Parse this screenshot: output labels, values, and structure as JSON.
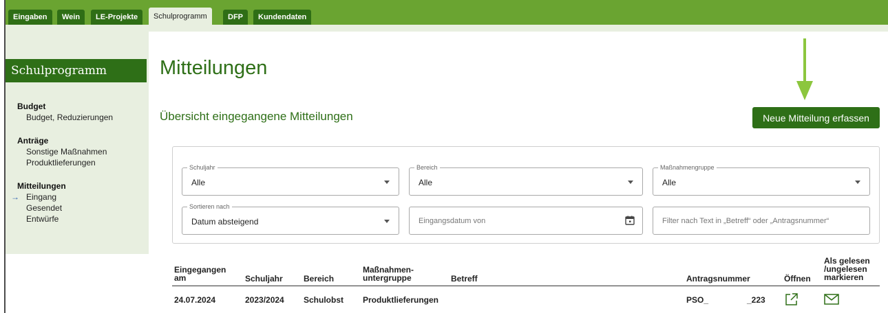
{
  "top_tabs": [
    {
      "label": "Eingaben",
      "active": false
    },
    {
      "label": "Wein",
      "active": false
    },
    {
      "label": "LE-Projekte",
      "active": false
    },
    {
      "label": "Schulprogramm",
      "active": true
    },
    {
      "label": "DFP",
      "active": false
    },
    {
      "label": "Kundendaten",
      "active": false
    }
  ],
  "sidebar": {
    "title": "Schulprogramm",
    "sections": [
      {
        "heading": "Budget",
        "items": [
          {
            "label": "Budget, Reduzierungen",
            "current": false
          }
        ]
      },
      {
        "heading": "Anträge",
        "items": [
          {
            "label": "Sonstige Maßnahmen",
            "current": false
          },
          {
            "label": "Produktlieferungen",
            "current": false
          }
        ]
      },
      {
        "heading": "Mitteilungen",
        "items": [
          {
            "label": "Eingang",
            "current": true
          },
          {
            "label": "Gesendet",
            "current": false
          },
          {
            "label": "Entwürfe",
            "current": false
          }
        ]
      }
    ],
    "current_arrow": "→"
  },
  "main": {
    "title": "Mitteilungen",
    "subtitle": "Übersicht eingegangene Mitteilungen",
    "new_button": "Neue Mitteilung erfassen"
  },
  "filters": {
    "schuljahr": {
      "label": "Schuljahr",
      "value": "Alle"
    },
    "bereich": {
      "label": "Bereich",
      "value": "Alle"
    },
    "massnahmengruppe": {
      "label": "Maßnahmengruppe",
      "value": "Alle"
    },
    "sortieren": {
      "label": "Sortieren nach",
      "value": "Datum absteigend"
    },
    "eingangsdatum": {
      "placeholder": "Eingangsdatum von"
    },
    "textfilter": {
      "placeholder": "Filter nach Text in „Betreff“ oder „Antragsnummer“"
    }
  },
  "table": {
    "headers": {
      "eingegangen": [
        "Eingegangen",
        "am"
      ],
      "schuljahr": "Schuljahr",
      "bereich": "Bereich",
      "massnahmen": [
        "Maßnahmen-",
        "untergruppe"
      ],
      "betreff": "Betreff",
      "antragsnummer": "Antragsnummer",
      "oeffnen": "Öffnen",
      "gelesen": [
        "Als gelesen",
        "/ungelesen",
        "markieren"
      ]
    },
    "rows": [
      {
        "eingegangen": "24.07.2024",
        "schuljahr": "2023/2024",
        "bereich": "Schulobst",
        "massnahmen": "Produktlieferungen",
        "betreff": "",
        "antrag_prefix": "PSO_",
        "antrag_suffix": "_223"
      }
    ]
  },
  "icons": {
    "open": "external-link-icon",
    "mark": "envelope-icon",
    "calendar": "calendar-icon",
    "annotation": "green-down-arrow"
  },
  "colors": {
    "brand_green": "#2e6f17",
    "topbar_green": "#6aa431",
    "light_green": "#e8efe0",
    "arrow_green": "#8cc63e"
  }
}
